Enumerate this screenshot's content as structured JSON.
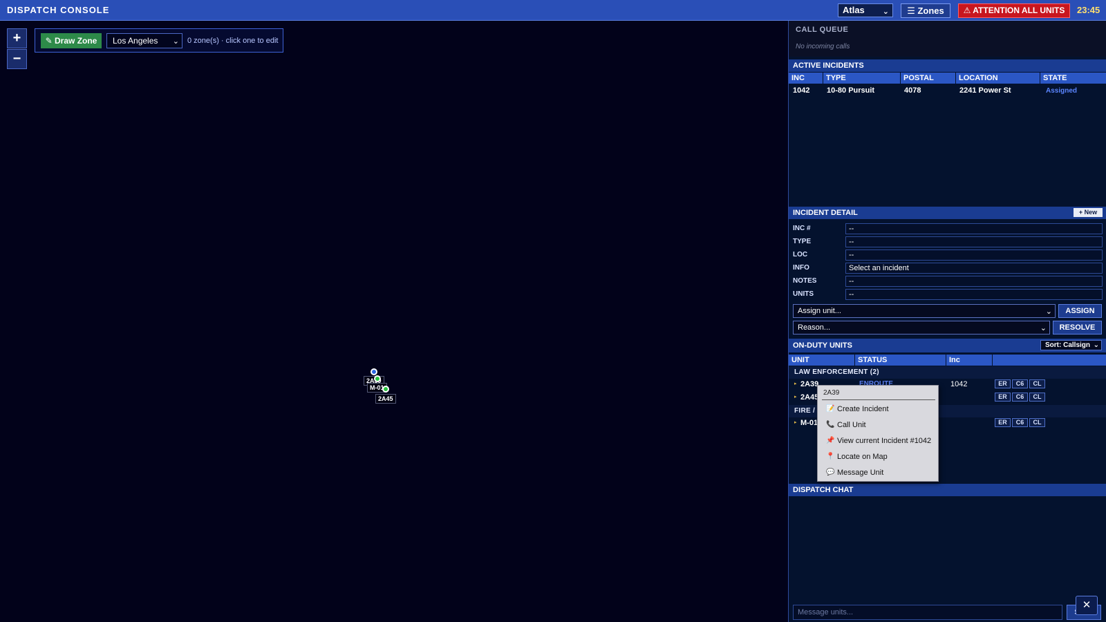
{
  "topbar": {
    "title": "DISPATCH CONSOLE",
    "map_select": "Atlas",
    "zones_label": "☰ Zones",
    "attention_label": "⚠ ATTENTION ALL UNITS",
    "clock": "23:45"
  },
  "map": {
    "zoom_in": "+",
    "zoom_out": "−",
    "draw_zone_label": "✎ Draw Zone",
    "city": "Los Angeles",
    "zone_hint": "0 zone(s) · click one to edit",
    "markers": [
      {
        "label": "2A39",
        "color": "blue"
      },
      {
        "label": "M-01",
        "color": "green"
      },
      {
        "label": "2A45",
        "color": "green"
      }
    ]
  },
  "call_queue": {
    "title": "CALL QUEUE",
    "empty_text": "No incoming calls"
  },
  "active_incidents": {
    "title": "ACTIVE INCIDENTS",
    "columns": [
      "INC",
      "TYPE",
      "POSTAL",
      "LOCATION",
      "STATE"
    ],
    "rows": [
      {
        "inc": "1042",
        "type": "10-80 Pursuit",
        "postal": "4078",
        "location": "2241 Power St",
        "state": "Assigned"
      }
    ]
  },
  "incident_detail": {
    "title": "INCIDENT DETAIL",
    "new_label": "+ New",
    "fields": [
      {
        "label": "INC #",
        "value": "--"
      },
      {
        "label": "TYPE",
        "value": "--"
      },
      {
        "label": "LOC",
        "value": "--"
      },
      {
        "label": "INFO",
        "value": "Select an incident"
      },
      {
        "label": "NOTES",
        "value": "--"
      },
      {
        "label": "UNITS",
        "value": "--"
      }
    ],
    "assign_placeholder": "Assign unit...",
    "assign_label": "ASSIGN",
    "reason_placeholder": "Reason...",
    "resolve_label": "RESOLVE"
  },
  "on_duty": {
    "title": "ON-DUTY UNITS",
    "sort_label": "Sort: Callsign",
    "columns": [
      "UNIT",
      "STATUS",
      "Inc"
    ],
    "groups": {
      "law": "LAW ENFORCEMENT (2)",
      "fire": "FIRE /"
    },
    "units": [
      {
        "callsign": "2A39",
        "status": "ENROUTE",
        "inc": "1042"
      },
      {
        "callsign": "2A45",
        "status": "",
        "inc": ""
      },
      {
        "callsign": "M-01",
        "status": "",
        "inc": ""
      }
    ],
    "buttons": [
      "ER",
      "C6",
      "CL"
    ]
  },
  "dispatch_chat": {
    "title": "DISPATCH CHAT",
    "placeholder": "Message units...",
    "send_label": "Send",
    "close_label": "✕"
  },
  "context_menu": {
    "title": "2A39",
    "items": [
      {
        "label": "Create Incident",
        "icon": "📝"
      },
      {
        "label": "Call Unit",
        "icon": "📞"
      },
      {
        "label": "View current Incident #1042",
        "icon": "📌"
      },
      {
        "label": "Locate on Map",
        "icon": "📍"
      },
      {
        "label": "Message Unit",
        "icon": "💬"
      }
    ]
  }
}
